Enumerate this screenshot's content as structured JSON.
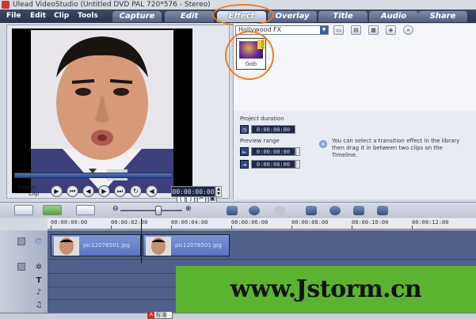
{
  "window": {
    "title": "Ulead VideoStudio (Untitled DVD PAL 720*576 - Stereo)"
  },
  "menu": {
    "items": [
      "File",
      "Edit",
      "Clip",
      "Tools"
    ]
  },
  "tabs": [
    {
      "label": "Capture",
      "active": false
    },
    {
      "label": "Edit",
      "active": false
    },
    {
      "label": "Effect",
      "active": true
    },
    {
      "label": "Overlay",
      "active": false
    },
    {
      "label": "Title",
      "active": false
    },
    {
      "label": "Audio",
      "active": false
    },
    {
      "label": "Share",
      "active": false
    }
  ],
  "preview": {
    "mode_project": "Project",
    "mode_clip": "Clip",
    "timecode": "00:00:00:00",
    "controls": [
      "play-icon",
      "home-icon",
      "previous-frame-icon",
      "next-frame-icon",
      "end-icon",
      "repeat-icon",
      "volume-icon"
    ]
  },
  "library": {
    "category": "Hollywood FX",
    "thumbnails": [
      {
        "label": "Gob",
        "badge": "GOLD"
      }
    ]
  },
  "options": {
    "duration_label": "Project duration",
    "duration_value": "0:00:00:00",
    "preview_range_label": "Preview range",
    "range_start": "0:00:00:00",
    "range_end": "0:00:06:00",
    "info": "You can select a transition effect in the library then drag it in between two clips on the Timeline."
  },
  "ruler": {
    "labels": [
      "00:00:00:00",
      "00:00:02:00",
      "00:00:04:00",
      "00:00:06:00",
      "00:00:08:00",
      "00:00:10:00",
      "00:00:12:00"
    ]
  },
  "timeline": {
    "clips": [
      {
        "name": "pic12076501.jpg"
      },
      {
        "name": "pic12076501.jpg"
      }
    ]
  },
  "watermark": {
    "text": "www.Jstorm.cn"
  },
  "taskbar": {
    "ime_label": "标准"
  },
  "colors": {
    "tab_bar": "#28324a",
    "highlight": "#f07c1a",
    "clip": "#6a84c8",
    "watermark_bg": "#5bb330"
  }
}
